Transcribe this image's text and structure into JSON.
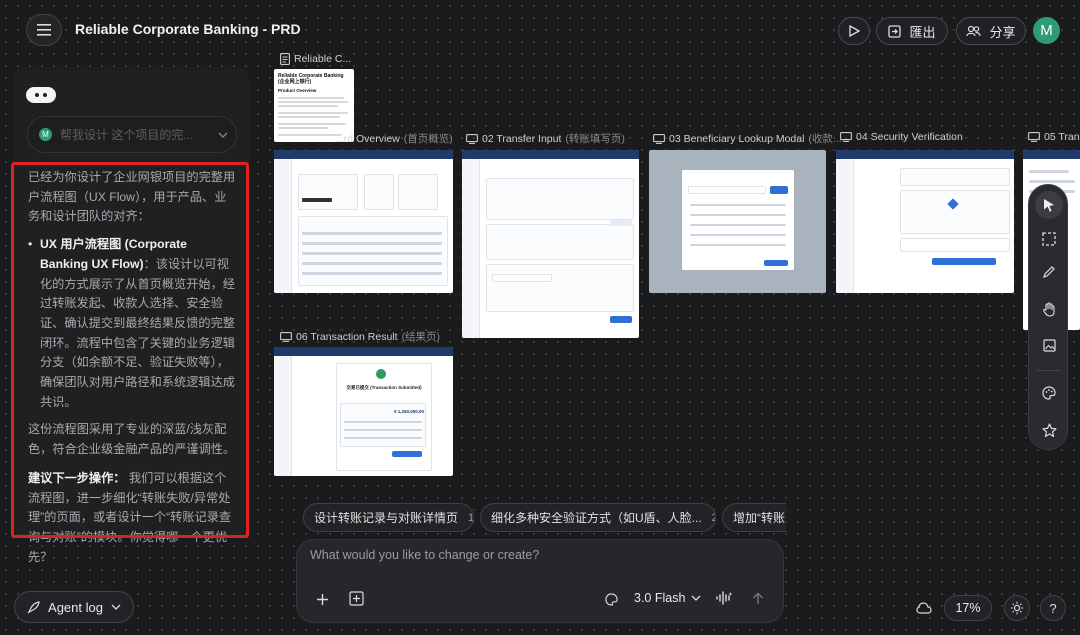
{
  "header": {
    "title": "Reliable Corporate Banking - PRD",
    "export_label": "匯出",
    "share_label": "分享",
    "avatar_letter": "M"
  },
  "chat": {
    "prompt_avatar": "M",
    "prompt_text": "帮我设计 这个项目的完...",
    "intro": "已经为你设计了企业网银项目的完整用户流程图（UX Flow），用于产品、业务和设计团队的对齐：",
    "bullet_title": "UX 用户流程图 (Corporate Banking UX Flow)",
    "bullet_body": "：该设计以可视化的方式展示了从首页概览开始，经过转账发起、收款人选择、安全验证、确认提交到最终结果反馈的完整闭环。流程中包含了关键的业务逻辑分支（如余额不足、验证失败等），确保团队对用户路径和系统逻辑达成共识。",
    "style_note": "这份流程图采用了专业的深蓝/浅灰配色，符合企业级金融产品的严谨调性。",
    "next_label": "建议下一步操作：",
    "next_body": "我们可以根据这个流程图，进一步细化“转账失败/异常处理”的页面，或者设计一个“转账记录查询与对账”的模块。你觉得哪一个更优先？"
  },
  "agent_log_label": "Agent log",
  "canvas": {
    "doc_card": {
      "label": "Reliable C...",
      "doc_title": "Reliable Corporate Banking (企业网上银行)",
      "doc_heading": "Product Overview"
    },
    "screens": [
      {
        "label": "...rd Overview",
        "sub": "(首页概览)"
      },
      {
        "label": "02 Transfer Input",
        "sub": "(转账填写页)"
      },
      {
        "label": "03 Beneficiary Lookup Modal",
        "sub": "(收款..."
      },
      {
        "label": "04 Security Verification",
        "sub": ""
      },
      {
        "label": "05 Trans",
        "sub": ""
      },
      {
        "label": "06 Transaction Result",
        "sub": "(结果页)"
      }
    ],
    "result_card_title": "交易已提交 (Transaction Submitted)",
    "result_amount": "¥ 1,250,000.00"
  },
  "suggestions": [
    {
      "text": "设计转账记录与对账详情页",
      "num": "1"
    },
    {
      "text": "细化多种安全验证方式（如U盾、人脸...",
      "num": "2"
    },
    {
      "text": "增加“转账"
    }
  ],
  "composer": {
    "placeholder": "What would you like to change or create?",
    "model": "3.0 Flash"
  },
  "zoom": "17%",
  "colors": {
    "accent_red": "#e0201c",
    "avatar_green": "#2e9a76",
    "frame_navy": "#1f3a6b"
  }
}
